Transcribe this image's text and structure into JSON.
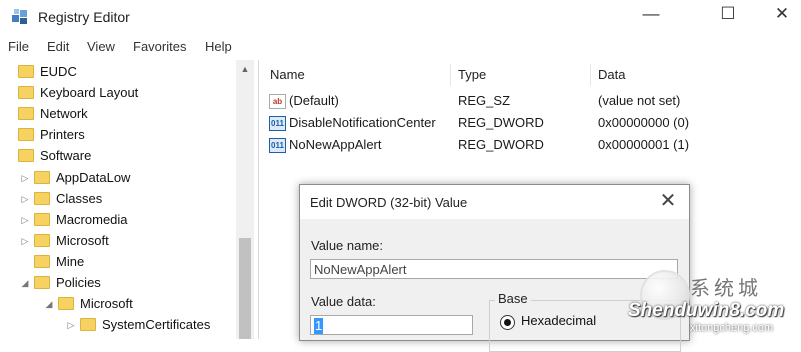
{
  "window": {
    "title": "Registry Editor",
    "controls": [
      "—",
      "☐",
      "✕"
    ]
  },
  "menu": [
    "File",
    "Edit",
    "View",
    "Favorites",
    "Help"
  ],
  "tree": [
    {
      "label": "EUDC"
    },
    {
      "label": "Keyboard Layout"
    },
    {
      "label": "Network"
    },
    {
      "label": "Printers"
    },
    {
      "label": "Software"
    },
    {
      "label": "AppDataLow"
    },
    {
      "label": "Classes"
    },
    {
      "label": "Macromedia"
    },
    {
      "label": "Microsoft"
    },
    {
      "label": "Mine"
    },
    {
      "label": "Policies"
    },
    {
      "label": "Microsoft"
    },
    {
      "label": "SystemCertificates"
    }
  ],
  "list": {
    "columns": [
      "Name",
      "Type",
      "Data"
    ],
    "rows": [
      {
        "icon": "string-value-icon",
        "glyph": "ab",
        "name": "(Default)",
        "type": "REG_SZ",
        "data": "(value not set)"
      },
      {
        "icon": "dword-value-icon",
        "glyph": "011",
        "name": "DisableNotificationCenter",
        "type": "REG_DWORD",
        "data": "0x00000000 (0)"
      },
      {
        "icon": "dword-value-icon",
        "glyph": "011",
        "name": "NoNewAppAlert",
        "type": "REG_DWORD",
        "data": "0x00000001 (1)"
      }
    ]
  },
  "dialog": {
    "title": "Edit DWORD (32-bit) Value",
    "close": "✕",
    "value_name_label": "Value name:",
    "value_name": "NoNewAppAlert",
    "value_data_label": "Value data:",
    "value_data": "1",
    "base_label": "Base",
    "base_option": "Hexadecimal",
    "base_selected": true
  },
  "watermark": {
    "brand_cn": "系统城",
    "brand_en": "Shenduwin8.com",
    "url": "xitongcheng.com"
  }
}
